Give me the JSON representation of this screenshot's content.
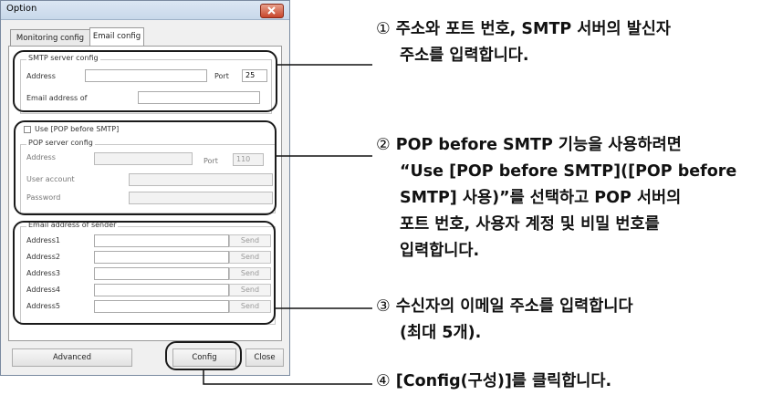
{
  "window": {
    "title": "Option",
    "tabs": [
      {
        "label": "Monitoring config"
      },
      {
        "label": "Email config"
      }
    ]
  },
  "smtp": {
    "legend": "SMTP server config",
    "address_label": "Address",
    "address_value": "",
    "port_label": "Port",
    "port_value": "25",
    "email_label": "Email address of",
    "email_value": ""
  },
  "pop": {
    "use_label": "Use [POP before SMTP]",
    "use_checked": false,
    "legend": "POP server config",
    "address_label": "Address",
    "port_label": "Port",
    "port_value": "110",
    "user_label": "User account",
    "password_label": "Password"
  },
  "sender": {
    "legend": "Email address of sender",
    "rows": [
      {
        "label": "Address1",
        "value": "",
        "send": "Send"
      },
      {
        "label": "Address2",
        "value": "",
        "send": "Send"
      },
      {
        "label": "Address3",
        "value": "",
        "send": "Send"
      },
      {
        "label": "Address4",
        "value": "",
        "send": "Send"
      },
      {
        "label": "Address5",
        "value": "",
        "send": "Send"
      }
    ]
  },
  "buttons": {
    "advanced": "Advanced",
    "config": "Config",
    "close": "Close"
  },
  "notes": [
    {
      "num": "①",
      "lines": [
        "주소와 포트 번호, SMTP 서버의 발신자",
        "주소를 입력합니다."
      ]
    },
    {
      "num": "②",
      "lines": [
        "POP before SMTP 기능을 사용하려면",
        "“Use [POP before SMTP]([POP before",
        "SMTP] 사용)”를 선택하고 POP 서버의",
        "포트 번호, 사용자 계정 및 비밀 번호를",
        "입력합니다."
      ]
    },
    {
      "num": "③",
      "lines": [
        "수신자의 이메일 주소를 입력합니다",
        "(최대 5개)."
      ]
    },
    {
      "num": "④",
      "lines": [
        "[Config(구성)]를 클릭합니다."
      ]
    }
  ]
}
